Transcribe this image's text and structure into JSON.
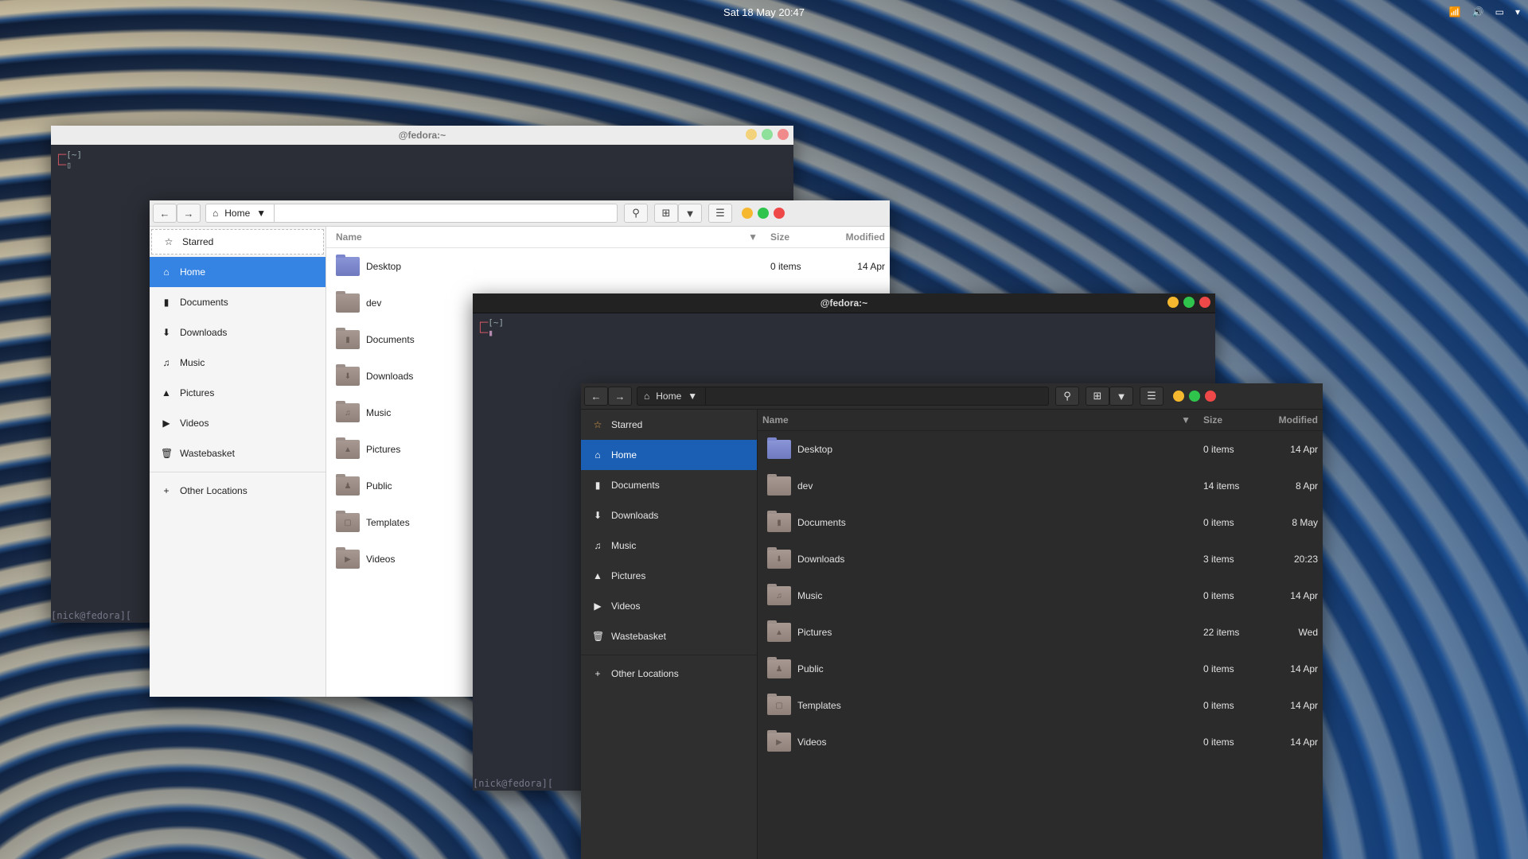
{
  "topbar": {
    "clock": "Sat 18 May  20:47",
    "tray_icons": [
      "wifi-icon",
      "volume-icon",
      "battery-icon",
      "chevron-down-icon"
    ]
  },
  "terminal_back": {
    "title": "@fedora:~",
    "prompt": "[~]",
    "status": "[nick@fedora]["
  },
  "terminal_front": {
    "title": "@fedora:~",
    "prompt": "[~]",
    "status": "[nick@fedora]["
  },
  "files_light": {
    "path": "Home",
    "sidebar": [
      {
        "label": "Starred",
        "icon": "star-icon"
      },
      {
        "label": "Home",
        "icon": "home-icon"
      },
      {
        "label": "Documents",
        "icon": "document-icon"
      },
      {
        "label": "Downloads",
        "icon": "download-icon"
      },
      {
        "label": "Music",
        "icon": "music-icon"
      },
      {
        "label": "Pictures",
        "icon": "pictures-icon"
      },
      {
        "label": "Videos",
        "icon": "video-icon"
      },
      {
        "label": "Wastebasket",
        "icon": "trash-icon"
      }
    ],
    "other_locations": "Other Locations",
    "columns": {
      "name": "Name",
      "size": "Size",
      "modified": "Modified"
    },
    "rows": [
      {
        "name": "Desktop",
        "size": "0 items",
        "modified": "14 Apr"
      },
      {
        "name": "dev",
        "size": "",
        "modified": ""
      },
      {
        "name": "Documents",
        "size": "",
        "modified": ""
      },
      {
        "name": "Downloads",
        "size": "",
        "modified": ""
      },
      {
        "name": "Music",
        "size": "",
        "modified": ""
      },
      {
        "name": "Pictures",
        "size": "",
        "modified": ""
      },
      {
        "name": "Public",
        "size": "",
        "modified": ""
      },
      {
        "name": "Templates",
        "size": "",
        "modified": ""
      },
      {
        "name": "Videos",
        "size": "",
        "modified": ""
      }
    ]
  },
  "files_dark": {
    "path": "Home",
    "sidebar": [
      {
        "label": "Starred",
        "icon": "star-icon"
      },
      {
        "label": "Home",
        "icon": "home-icon"
      },
      {
        "label": "Documents",
        "icon": "document-icon"
      },
      {
        "label": "Downloads",
        "icon": "download-icon"
      },
      {
        "label": "Music",
        "icon": "music-icon"
      },
      {
        "label": "Pictures",
        "icon": "pictures-icon"
      },
      {
        "label": "Videos",
        "icon": "video-icon"
      },
      {
        "label": "Wastebasket",
        "icon": "trash-icon"
      }
    ],
    "other_locations": "Other Locations",
    "columns": {
      "name": "Name",
      "size": "Size",
      "modified": "Modified"
    },
    "rows": [
      {
        "name": "Desktop",
        "size": "0 items",
        "modified": "14 Apr"
      },
      {
        "name": "dev",
        "size": "14 items",
        "modified": "8 Apr"
      },
      {
        "name": "Documents",
        "size": "0 items",
        "modified": "8 May"
      },
      {
        "name": "Downloads",
        "size": "3 items",
        "modified": "20:23"
      },
      {
        "name": "Music",
        "size": "0 items",
        "modified": "14 Apr"
      },
      {
        "name": "Pictures",
        "size": "22 items",
        "modified": "Wed"
      },
      {
        "name": "Public",
        "size": "0 items",
        "modified": "14 Apr"
      },
      {
        "name": "Templates",
        "size": "0 items",
        "modified": "14 Apr"
      },
      {
        "name": "Videos",
        "size": "0 items",
        "modified": "14 Apr"
      }
    ]
  },
  "colors": {
    "accent_light": "#3584e4",
    "accent_dark": "#1b5fb5",
    "close": "#ee4848",
    "minimize": "#f5b82e",
    "maximize": "#2fc54c"
  }
}
